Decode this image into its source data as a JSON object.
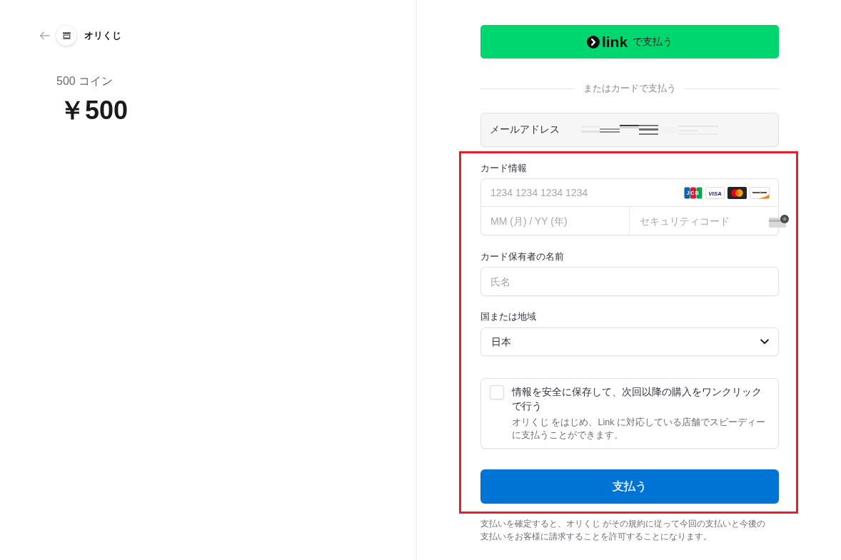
{
  "merchant": {
    "name": "オリくじ"
  },
  "product": {
    "name": "500 コイン",
    "price": "￥500"
  },
  "link_button": {
    "logo_text": "link",
    "label": "で支払う"
  },
  "divider": {
    "label": "またはカードで支払う"
  },
  "email": {
    "label": "メールアドレス",
    "redacted": true
  },
  "highlight_box": true,
  "card": {
    "label": "カード情報",
    "number_placeholder": "1234 1234 1234 1234",
    "brands": [
      {
        "kind": "jcb",
        "text": "JCB"
      },
      {
        "kind": "visa",
        "text": "VISA"
      },
      {
        "kind": "mastercard"
      },
      {
        "kind": "discover"
      }
    ],
    "expiry_placeholder": "MM (月) / YY (年)",
    "cvc_placeholder": "セキュリティコード"
  },
  "cardholder": {
    "label": "カード保有者の名前",
    "placeholder": "氏名"
  },
  "country": {
    "label": "国または地域",
    "value": "日本"
  },
  "save_info": {
    "checked": false,
    "title": "情報を安全に保存して、次回以降の購入をワンクリックで行う",
    "description": "オリくじ をはじめ、Link に対応している店舗でスピーディーに支払うことができます。"
  },
  "pay_button": {
    "label": "支払う"
  },
  "terms": "支払いを確定すると、オリくじ がその規約に従って今回の支払いと今後の支払いをお客様に請求することを許可することになります。"
}
